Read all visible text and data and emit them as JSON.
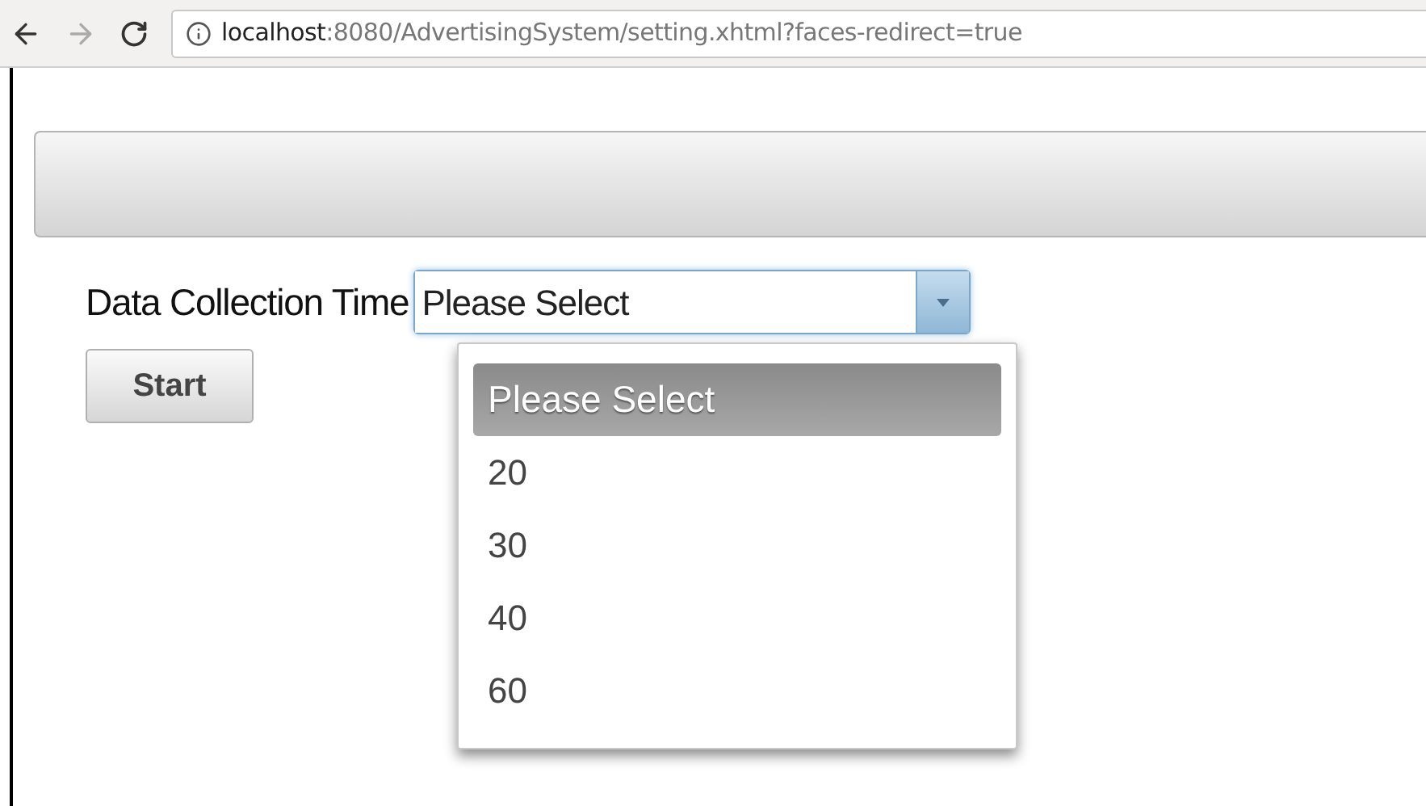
{
  "browser": {
    "url_host": "localhost",
    "url_rest": ":8080/AdvertisingSystem/setting.xhtml?faces-redirect=true"
  },
  "form": {
    "label": "Data Collection Time",
    "select_value": "Please Select",
    "button": "Start"
  },
  "dropdown": {
    "open": true,
    "options": [
      {
        "label": "Please Select",
        "selected": true
      },
      {
        "label": "20",
        "selected": false
      },
      {
        "label": "30",
        "selected": false
      },
      {
        "label": "40",
        "selected": false
      },
      {
        "label": "60",
        "selected": false
      }
    ]
  }
}
